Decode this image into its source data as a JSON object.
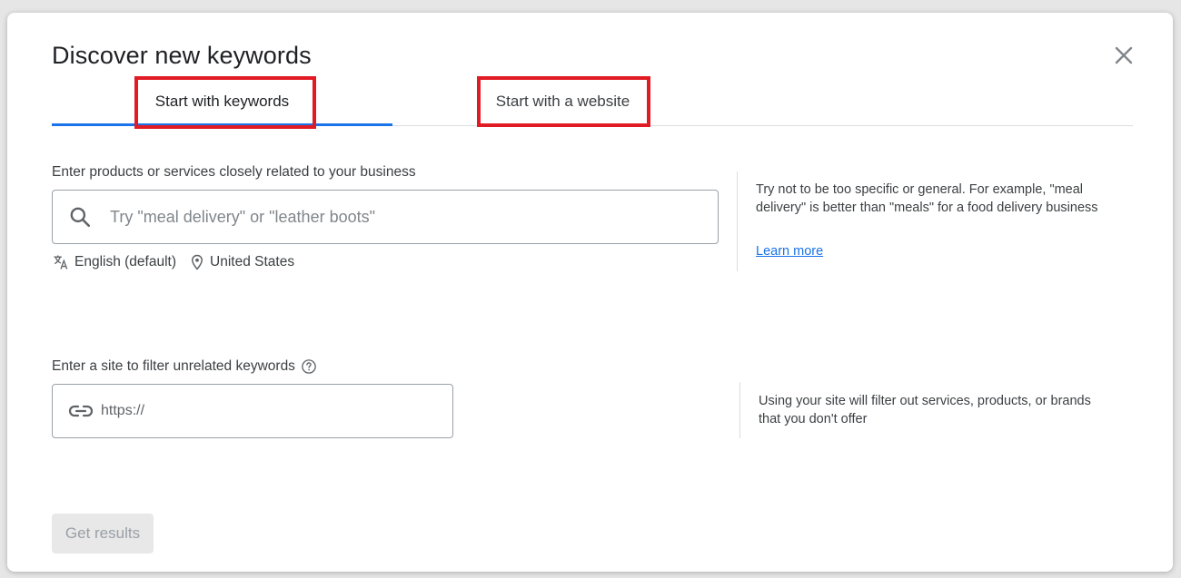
{
  "dialog": {
    "title": "Discover new keywords"
  },
  "tabs": [
    {
      "label": "Start with keywords",
      "active": true
    },
    {
      "label": "Start with a website",
      "active": false
    }
  ],
  "keywords_section": {
    "label": "Enter products or services closely related to your business",
    "placeholder": "Try \"meal delivery\" or \"leather boots\"",
    "value": "",
    "language": "English (default)",
    "location": "United States",
    "help_text": "Try not to be too specific or general. For example, \"meal delivery\" is better than \"meals\" for a food delivery business",
    "learn_more": "Learn more"
  },
  "site_section": {
    "label": "Enter a site to filter unrelated keywords",
    "placeholder": "https://",
    "value": "",
    "help_text": "Using your site will filter out services, products, or brands that you don't offer"
  },
  "actions": {
    "get_results": "Get results",
    "get_results_enabled": false
  },
  "colors": {
    "accent": "#1a73e8",
    "highlight_box": "#e01b24",
    "disabled_button_bg": "#e8e8e8"
  },
  "icons": [
    "close-icon",
    "search-icon",
    "translate-icon",
    "location-pin-icon",
    "help-circle-icon",
    "link-icon"
  ]
}
